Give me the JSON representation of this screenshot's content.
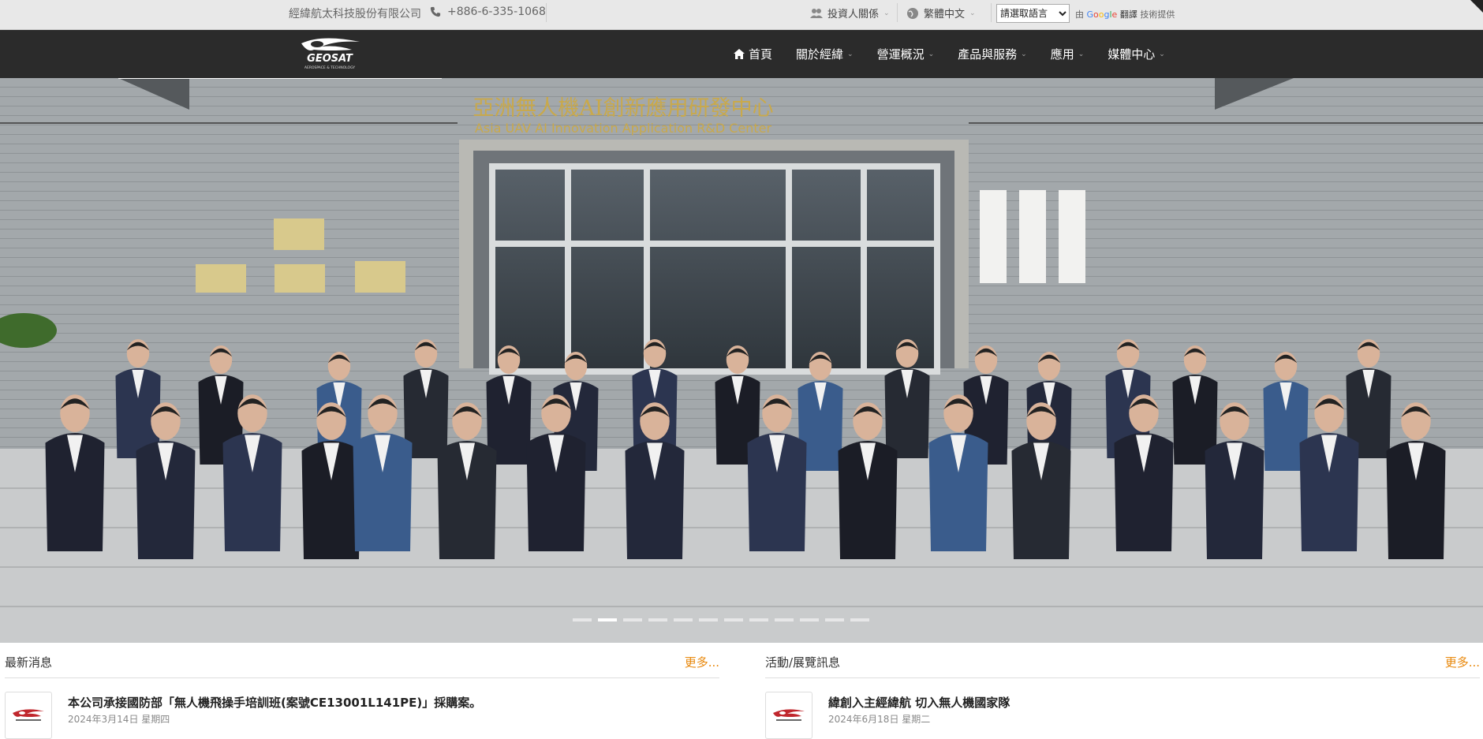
{
  "topbar": {
    "company": "經緯航太科技股份有限公司",
    "phone": "+886-6-335-1068",
    "investor": "投資人關係",
    "language": "繁體中文",
    "translate_select": "請選取語言",
    "translate_prefix": "由",
    "translate_google": "Google",
    "translate_word": "翻譯",
    "translate_suffix": "技術提供"
  },
  "navbar": {
    "logo_text": "GEOSAT",
    "logo_sub": "AEROSPACE & TECHNOLOGY",
    "items": [
      "首頁",
      "關於經緯",
      "營運概況",
      "產品與服務",
      "應用",
      "媒體中心"
    ]
  },
  "hero": {
    "sign_cn": "亞洲無人機AI創新應用研發中心",
    "sign_en": "Asia UAV AI Innovation Application R&D Center",
    "slide_count": 12,
    "active_slide": 1
  },
  "news": {
    "title": "最新消息",
    "more": "更多...",
    "items": [
      {
        "headline": "本公司承接國防部「無人機飛操手培訓班(案號CE13001L141PE)」採購案。",
        "date": "2024年3月14日 星期四"
      }
    ]
  },
  "events": {
    "title": "活動/展覽訊息",
    "more": "更多...",
    "items": [
      {
        "headline": "緯創入主經緯航 切入無人機國家隊",
        "date": "2024年6月18日 星期二"
      }
    ]
  },
  "colors": {
    "topbar_bg": "#e8e8e8",
    "navbar_bg": "#2b2b2b",
    "more_link": "#e8880c"
  }
}
